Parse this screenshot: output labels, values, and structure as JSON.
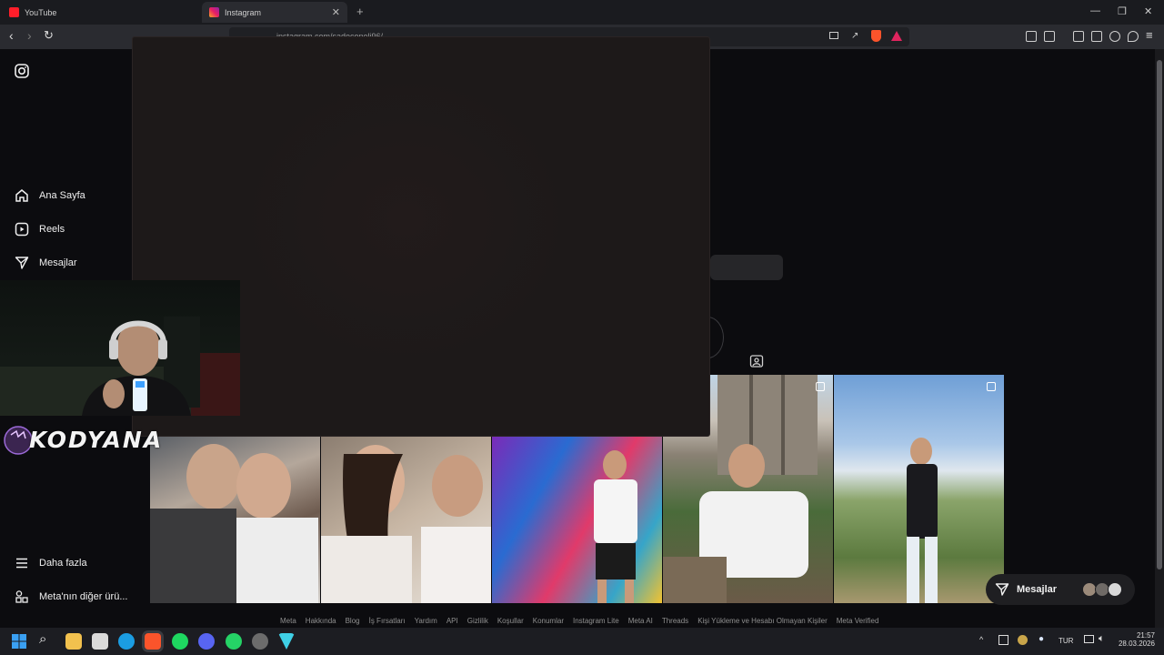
{
  "browser": {
    "tabs": [
      {
        "label": "YouTube"
      },
      {
        "label": "Instagram"
      }
    ],
    "url": "instagram.com/sadeconeli96/"
  },
  "sidebar": {
    "items": [
      {
        "label": "Ana Sayfa",
        "icon": "home-icon"
      },
      {
        "label": "Reels",
        "icon": "reels-icon"
      },
      {
        "label": "Mesajlar",
        "icon": "send-icon"
      }
    ],
    "bottom": [
      {
        "label": "Daha fazla",
        "icon": "menu-icon"
      },
      {
        "label": "Meta'nın diğer ürü...",
        "icon": "meta-apps-icon"
      }
    ]
  },
  "overlay": {
    "streamer_logo": "KODYANA"
  },
  "footer_links": [
    "Meta",
    "Hakkında",
    "Blog",
    "İş Fırsatları",
    "Yardım",
    "API",
    "Gizlilik",
    "Koşullar",
    "Konumlar",
    "Instagram Lite",
    "Meta AI",
    "Threads",
    "Kişi Yükleme ve Hesabı Olmayan Kişiler",
    "Meta Verified"
  ],
  "messages_pill": {
    "label": "Mesajlar"
  },
  "taskbar": {
    "lang": "TUR",
    "time": "21:57",
    "date": "28.03.2026"
  },
  "colors": {
    "page_bg": "#0c0c0f",
    "modal_bg": "#1d1919",
    "instagram_gradient": "#e91e63"
  }
}
